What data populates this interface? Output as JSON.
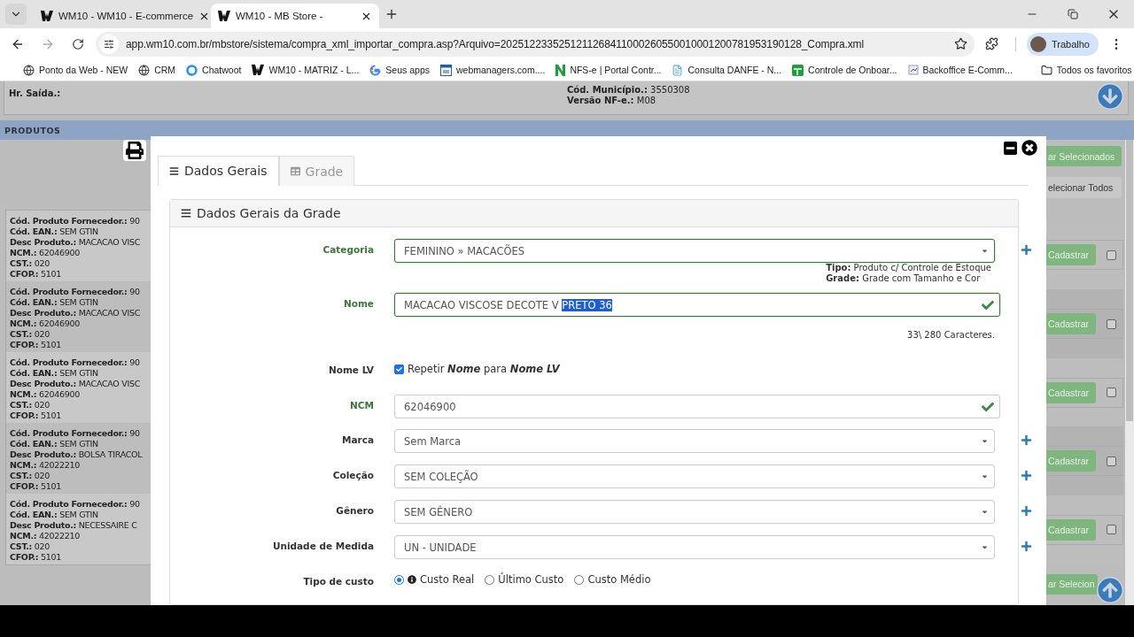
{
  "browser": {
    "tabs": [
      {
        "title": "WM10 - WM10 - E-commerce",
        "selected": false
      },
      {
        "title": "WM10 - MB Store -",
        "selected": true
      }
    ],
    "url": "app.wm10.com.br/mbstore/sistema/compra_xml_importar_compra.asp?Arquivo=2025122335251211268411000260550010001200781953190128_Compra.xml",
    "profile": "Trabalho",
    "bookmarks": [
      {
        "kind": "globe",
        "label": "Ponto da Web - NEW"
      },
      {
        "kind": "globe",
        "label": "CRM"
      },
      {
        "kind": "ring",
        "label": "Chatwoot"
      },
      {
        "kind": "logo",
        "label": "WM10 - MATRIZ - L..."
      },
      {
        "kind": "google",
        "label": "Seus apps"
      },
      {
        "kind": "calendar",
        "label": "webmanagers.com...."
      },
      {
        "kind": "nlogo",
        "label": "NFS-e | Portal Contr..."
      },
      {
        "kind": "doc",
        "label": "Consulta DANFE - N..."
      },
      {
        "kind": "sheet",
        "label": "Controle de Onboar..."
      },
      {
        "kind": "chart",
        "label": "Backoffice E-Comm..."
      }
    ],
    "all_bookmarks": "Todos os favoritos"
  },
  "page": {
    "info_left": [
      "Hr. Saída.:"
    ],
    "info_center": [
      {
        "label": "Cód. Município.:",
        "value": "3550308"
      },
      {
        "label": "Versão NF-e.:",
        "value": "M08"
      }
    ],
    "section_title": "PRODUTOS",
    "products": [
      {
        "fields": [
          {
            "label": "Cód. Produto Fornecedor.:",
            "value": "90"
          },
          {
            "label": "Cód. EAN.:",
            "value": "SEM GTIN"
          },
          {
            "label": "Desc Produto.:",
            "value": "MACACAO VISC"
          },
          {
            "label": "NCM.:",
            "value": "62046900"
          },
          {
            "label": "CST.:",
            "value": "020"
          },
          {
            "label": "CFOP.:",
            "value": "5101"
          }
        ]
      },
      {
        "fields": [
          {
            "label": "Cód. Produto Fornecedor.:",
            "value": "90"
          },
          {
            "label": "Cód. EAN.:",
            "value": "SEM GTIN"
          },
          {
            "label": "Desc Produto.:",
            "value": "MACACAO VISC"
          },
          {
            "label": "NCM.:",
            "value": "62046900"
          },
          {
            "label": "CST.:",
            "value": "020"
          },
          {
            "label": "CFOP.:",
            "value": "5101"
          }
        ]
      },
      {
        "fields": [
          {
            "label": "Cód. Produto Fornecedor.:",
            "value": "90"
          },
          {
            "label": "Cód. EAN.:",
            "value": "SEM GTIN"
          },
          {
            "label": "Desc Produto.:",
            "value": "MACACAO VISC"
          },
          {
            "label": "NCM.:",
            "value": "62046900"
          },
          {
            "label": "CST.:",
            "value": "020"
          },
          {
            "label": "CFOP.:",
            "value": "5101"
          }
        ]
      },
      {
        "fields": [
          {
            "label": "Cód. Produto Fornecedor.:",
            "value": "90"
          },
          {
            "label": "Cód. EAN.:",
            "value": "SEM GTIN"
          },
          {
            "label": "Desc Produto.:",
            "value": "BOLSA TIRACOL"
          },
          {
            "label": "NCM.:",
            "value": "42022210"
          },
          {
            "label": "CST.:",
            "value": "020"
          },
          {
            "label": "CFOP.:",
            "value": "5101"
          }
        ]
      },
      {
        "fields": [
          {
            "label": "Cód. Produto Fornecedor.:",
            "value": "90"
          },
          {
            "label": "Cód. EAN.:",
            "value": "SEM GTIN"
          },
          {
            "label": "Desc Produto.:",
            "value": "NECESSAIRE C"
          },
          {
            "label": "NCM.:",
            "value": "42022210"
          },
          {
            "label": "CST.:",
            "value": "020"
          },
          {
            "label": "CFOP.:",
            "value": "5101"
          }
        ]
      }
    ],
    "top_buttons": [
      {
        "label": "ar Selecionados",
        "kind": "primary"
      },
      {
        "label": "elecionar Todos",
        "kind": "secondary"
      }
    ],
    "rows": [
      {
        "button": "Cadastrar",
        "checked": false
      },
      {
        "button": "Cadastrar",
        "checked": false
      },
      {
        "button": "Cadastrar",
        "checked": false
      },
      {
        "button": "Cadastrar",
        "checked": false
      },
      {
        "button": "Cadastrar",
        "checked": false
      }
    ],
    "bottom_button": "ar Selecion"
  },
  "modal": {
    "tabs": [
      {
        "label": "Dados Gerais",
        "selected": true
      },
      {
        "label": "Grade",
        "selected": false
      }
    ],
    "panel_title": "Dados Gerais da Grade",
    "fields": [
      {
        "kind": "select",
        "label": "Categoria",
        "valid": true,
        "value": "FEMININO » MACACÕES",
        "addable": true,
        "notes": [
          {
            "label": "Tipo:",
            "value": "Produto c/ Controle de Estoque"
          },
          {
            "label": "Grade:",
            "value": "Grade com Tamanho e Cor"
          }
        ]
      },
      {
        "kind": "input",
        "label": "Nome",
        "valid": true,
        "check": true,
        "value": "MACACAO VISCOSE DECOTE V",
        "highlighted": "PRETO 36",
        "counter": "33\\ 280 Caracteres."
      },
      {
        "kind": "checkbox",
        "label": "Nome LV",
        "checked": true,
        "text": "Repetir **Nome** para **Nome LV**"
      },
      {
        "kind": "input",
        "label": "NCM",
        "valid": true,
        "check": true,
        "value": "62046900"
      },
      {
        "kind": "select",
        "label": "Marca",
        "valid": false,
        "value": "Sem Marca",
        "addable": true
      },
      {
        "kind": "select",
        "label": "Coleção",
        "valid": false,
        "value": "SEM COLEÇÃO",
        "addable": true
      },
      {
        "kind": "select",
        "label": "Gênero",
        "valid": false,
        "value": "SEM GÊNERO",
        "addable": true
      },
      {
        "kind": "select",
        "label": "Unidade de Medida",
        "valid": false,
        "value": "UN - UNIDADE",
        "addable": true
      },
      {
        "kind": "radio",
        "label": "Tipo de custo",
        "options": [
          {
            "label": "Custo Real",
            "selected": true,
            "info": true
          },
          {
            "label": "Último Custo",
            "selected": false,
            "info": false
          },
          {
            "label": "Custo Médio",
            "selected": false,
            "info": false
          }
        ]
      }
    ]
  }
}
